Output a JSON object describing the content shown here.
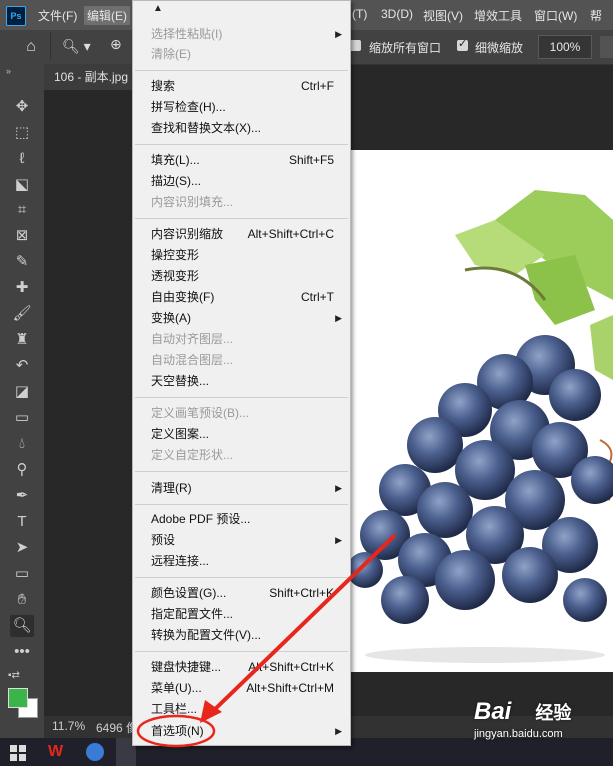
{
  "app": {
    "logo_text": "Ps"
  },
  "menubar": {
    "items": [
      {
        "label": "文件(F)"
      },
      {
        "label": "编辑(E)"
      },
      {
        "label": "(T)"
      },
      {
        "label": "3D(D)"
      },
      {
        "label": "视图(V)"
      },
      {
        "label": "增效工具"
      },
      {
        "label": "窗口(W)"
      },
      {
        "label": "帮"
      }
    ]
  },
  "options_bar": {
    "resize_windows_label": "缩放所有窗口",
    "scrubby_zoom_label": "细微缩放",
    "scrubby_zoom_checked": true,
    "zoom_value": "100%"
  },
  "document": {
    "tab_title": "106 - 副本.jpg",
    "status_zoom": "11.7%",
    "status_size": "6496 像"
  },
  "swatches": {
    "foreground": "#3bb54a",
    "background": "#ffffff"
  },
  "edit_menu": {
    "items": [
      {
        "label": "选择性粘贴(I)",
        "disabled": true,
        "submenu": true
      },
      {
        "label": "清除(E)",
        "disabled": true
      },
      {
        "label": "搜索",
        "shortcut": "Ctrl+F"
      },
      {
        "label": "拼写检查(H)..."
      },
      {
        "label": "查找和替换文本(X)..."
      },
      {
        "label": "填充(L)...",
        "shortcut": "Shift+F5"
      },
      {
        "label": "描边(S)..."
      },
      {
        "label": "内容识别填充...",
        "disabled": true
      },
      {
        "label": "内容识别缩放",
        "shortcut": "Alt+Shift+Ctrl+C"
      },
      {
        "label": "操控变形"
      },
      {
        "label": "透视变形"
      },
      {
        "label": "自由变换(F)",
        "shortcut": "Ctrl+T"
      },
      {
        "label": "变换(A)",
        "submenu": true
      },
      {
        "label": "自动对齐图层...",
        "disabled": true
      },
      {
        "label": "自动混合图层...",
        "disabled": true
      },
      {
        "label": "天空替换..."
      },
      {
        "label": "定义画笔预设(B)...",
        "disabled": true
      },
      {
        "label": "定义图案..."
      },
      {
        "label": "定义自定形状...",
        "disabled": true
      },
      {
        "label": "清理(R)",
        "submenu": true
      },
      {
        "label": "Adobe PDF 预设..."
      },
      {
        "label": "预设",
        "submenu": true
      },
      {
        "label": "远程连接..."
      },
      {
        "label": "颜色设置(G)...",
        "shortcut": "Shift+Ctrl+K"
      },
      {
        "label": "指定配置文件..."
      },
      {
        "label": "转换为配置文件(V)..."
      },
      {
        "label": "键盘快捷键...",
        "shortcut": "Alt+Shift+Ctrl+K"
      },
      {
        "label": "菜单(U)...",
        "shortcut": "Alt+Shift+Ctrl+M"
      },
      {
        "label": "工具栏..."
      },
      {
        "label": "首选项(N)",
        "submenu": true
      }
    ]
  },
  "watermark": {
    "line1": "Bai",
    "line2": "经验",
    "url": "jingyan.baidu.com"
  },
  "colors": {
    "highlight_red": "#e8261c",
    "menu_bg": "#f0f0f0"
  }
}
